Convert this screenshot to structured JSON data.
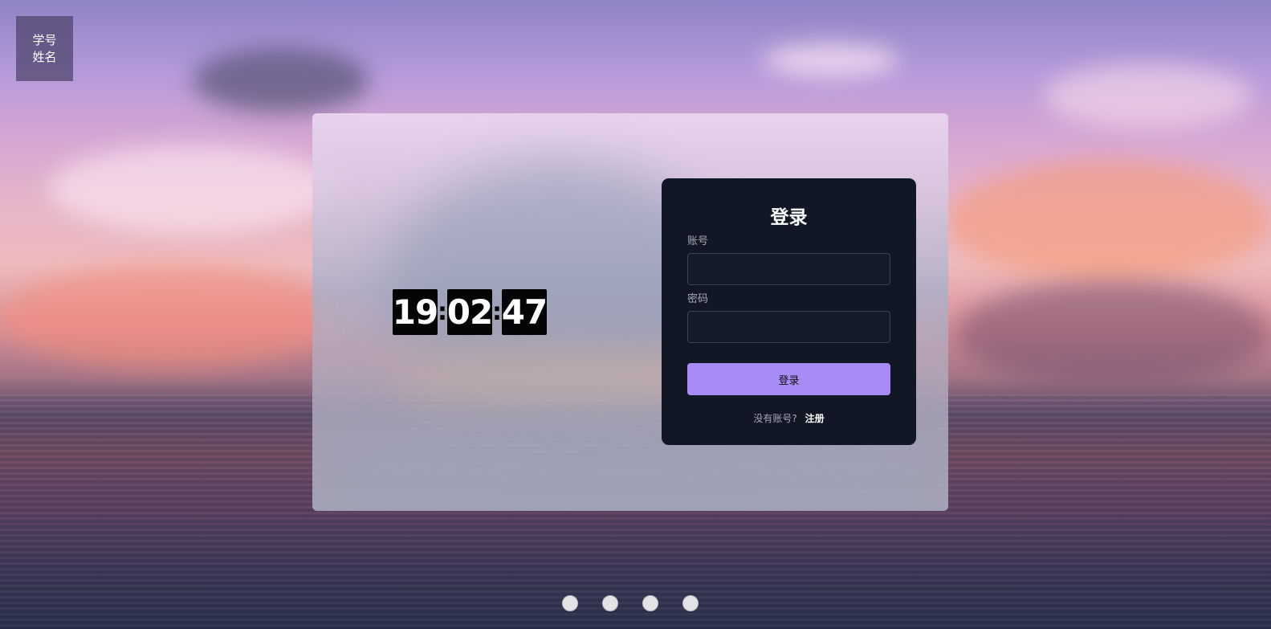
{
  "badge": {
    "line1": "学号",
    "line2": "姓名"
  },
  "clock": {
    "hours": "19",
    "minutes": "02",
    "seconds": "47",
    "separator": ":"
  },
  "login": {
    "title": "登录",
    "account_label": "账号",
    "account_value": "",
    "password_label": "密码",
    "password_value": "",
    "submit_label": "登录",
    "no_account_text": "没有账号?",
    "register_label": "注册"
  },
  "carousel": {
    "dot_count": 4
  },
  "colors": {
    "card_bg": "#121726",
    "button_accent": "#a98bf5",
    "clock_digit_bg": "#050505"
  }
}
